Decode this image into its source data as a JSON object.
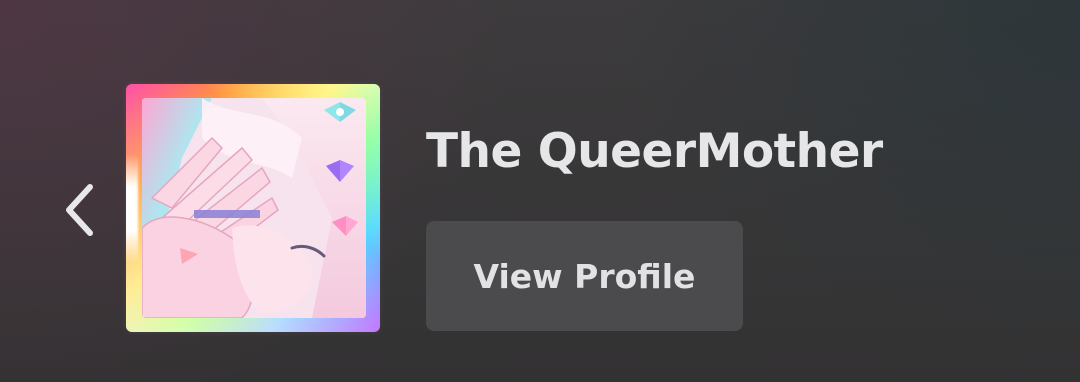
{
  "header": {
    "back_icon": "chevron-left-icon"
  },
  "profile": {
    "display_name": "The QueerMother",
    "avatar_icon": "avatar-image"
  },
  "actions": {
    "view_profile_label": "View Profile"
  },
  "colors": {
    "text": "#e6e6e8",
    "button_bg": "#4b4a4c",
    "background": "#383738"
  }
}
